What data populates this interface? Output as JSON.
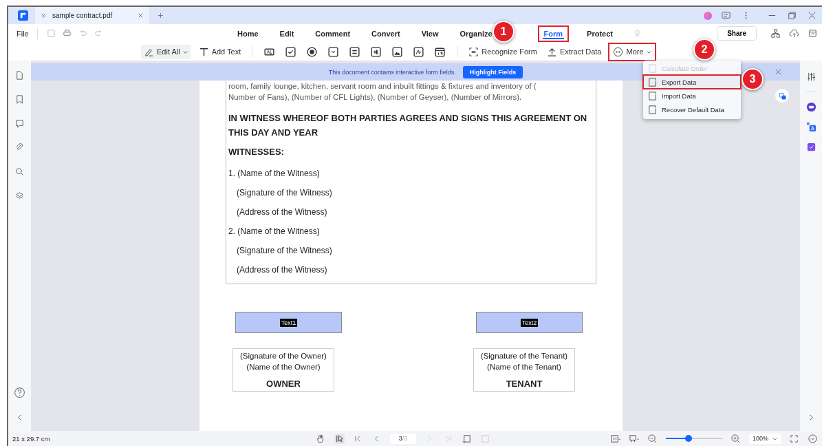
{
  "tab": {
    "title": "sample contract.pdf"
  },
  "menu": {
    "file": "File",
    "tabs": [
      {
        "label": "Home",
        "selected": false,
        "highlighted": false
      },
      {
        "label": "Edit",
        "selected": false,
        "highlighted": false
      },
      {
        "label": "Comment",
        "selected": false,
        "highlighted": false
      },
      {
        "label": "Convert",
        "selected": false,
        "highlighted": false
      },
      {
        "label": "View",
        "selected": false,
        "highlighted": false
      },
      {
        "label": "Organize",
        "selected": false,
        "highlighted": false
      },
      {
        "label": "Form",
        "selected": true,
        "highlighted": true
      },
      {
        "label": "Protect",
        "selected": false,
        "highlighted": false
      }
    ],
    "share": "Share"
  },
  "toolbar": {
    "edit_all": "Edit All",
    "add_text": "Add Text",
    "recognize_form": "Recognize Form",
    "extract_data": "Extract Data",
    "more": {
      "label": "More",
      "highlighted": true
    }
  },
  "more_menu": [
    {
      "label": "Calculate Order",
      "disabled": true,
      "highlighted": false
    },
    {
      "label": "Export Data",
      "disabled": false,
      "highlighted": true
    },
    {
      "label": "Import Data",
      "disabled": false,
      "highlighted": false
    },
    {
      "label": "Recover Default Data",
      "disabled": false,
      "highlighted": false
    }
  ],
  "callouts": [
    "1",
    "2",
    "3"
  ],
  "banner": {
    "message": "This document contains interactive form fields.",
    "button": "Highlight Fields"
  },
  "document": {
    "paragraph_lines": [
      "room, family lounge, kitchen, servant room and inbuilt fittings & fixtures and inventory of (",
      "Number of Fans), (Number of CFL Lights), (Number of Geyser), (Number of Mirrors)."
    ],
    "heading": "IN WITNESS WHEREOF BOTH PARTIES AGREES AND SIGNS THIS AGREEMENT ON THIS DAY AND YEAR",
    "witnesses_title": "WITNESSES:",
    "witnesses": [
      {
        "name": "1. (Name of the Witness)",
        "signature": "(Signature of the Witness)",
        "address": "(Address of the Witness)"
      },
      {
        "name": "2. (Name of the Witness)",
        "signature": "(Signature of the Witness)",
        "address": "(Address of the Witness)"
      }
    ]
  },
  "signatures": [
    {
      "field": "Text1",
      "lines": [
        "(Signature of the Owner)",
        "(Name of the Owner)"
      ],
      "role": "OWNER"
    },
    {
      "field": "Text2",
      "lines": [
        "(Signature of the Tenant)",
        "(Name of the Tenant)"
      ],
      "role": "TENANT"
    }
  ],
  "status_bar": {
    "page_size": "21 x 29.7 cm",
    "page_input": "3",
    "page_total": "/3",
    "zoom": "100%",
    "zoom_slider": {
      "level": 0.4
    }
  }
}
